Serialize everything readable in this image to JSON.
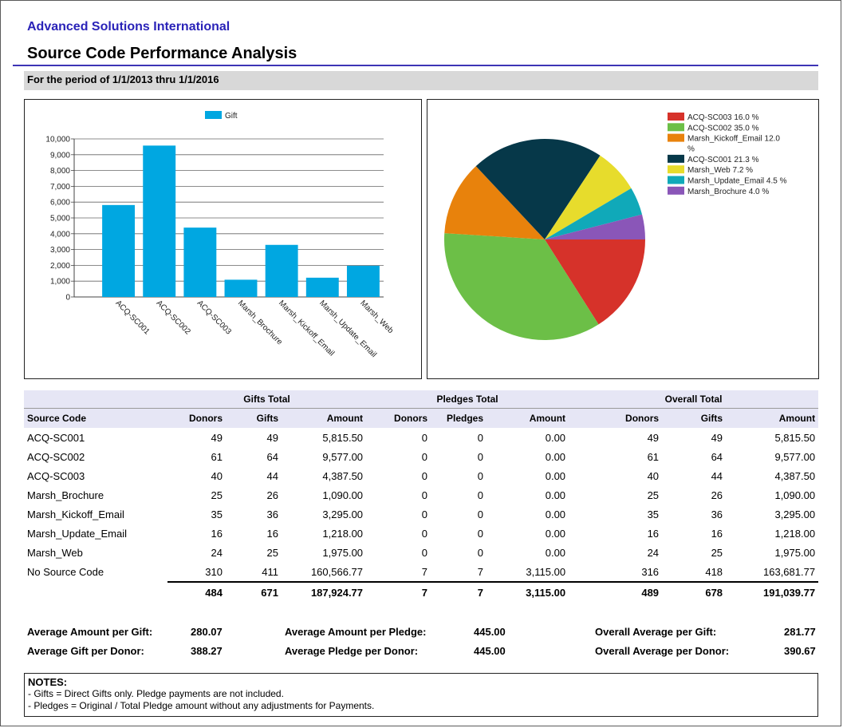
{
  "header": {
    "org": "Advanced Solutions International",
    "title": "Source Code Performance Analysis",
    "period": "For the period of 1/1/2013 thru 1/1/2016"
  },
  "chart_data": [
    {
      "type": "bar",
      "legend": [
        "Gift"
      ],
      "categories": [
        "ACQ-SC001",
        "ACQ-SC002",
        "ACQ-SC003",
        "Marsh_Brochure",
        "Marsh_Kickoff_Email",
        "Marsh_Update_Email",
        "Marsh_Web"
      ],
      "series": [
        {
          "name": "Gift",
          "values": [
            5815.5,
            9577.0,
            4387.5,
            1090.0,
            3295.0,
            1218.0,
            1975.0
          ]
        }
      ],
      "ylim": [
        0,
        10000
      ],
      "yticks": [
        "0",
        "1,000",
        "2,000",
        "3,000",
        "4,000",
        "5,000",
        "6,000",
        "7,000",
        "8,000",
        "9,000",
        "10,000"
      ],
      "grid": true,
      "legend_position": "top",
      "color": "#00a7e1"
    },
    {
      "type": "pie",
      "legend_position": "top-right",
      "slices": [
        {
          "label": "ACQ-SC003 16.0 %",
          "value": 16.0,
          "color": "#d6322a"
        },
        {
          "label": "ACQ-SC002 35.0 %",
          "value": 35.0,
          "color": "#6cbf47"
        },
        {
          "label": "Marsh_Kickoff_Email 12.0 %",
          "value": 12.0,
          "color": "#e8820c"
        },
        {
          "label": "ACQ-SC001 21.3 %",
          "value": 21.3,
          "color": "#063849"
        },
        {
          "label": "Marsh_Web 7.2 %",
          "value": 7.2,
          "color": "#e7dc2c"
        },
        {
          "label": "Marsh_Update_Email 4.5 %",
          "value": 4.5,
          "color": "#10a9b9"
        },
        {
          "label": "Marsh_Brochure 4.0 %",
          "value": 4.0,
          "color": "#8a56b8"
        }
      ]
    }
  ],
  "table": {
    "groups": [
      "Gifts Total",
      "Pledges Total",
      "Overall Total"
    ],
    "columns": [
      "Source Code",
      "Donors",
      "Gifts",
      "Amount",
      "Donors",
      "Pledges",
      "Amount",
      "Donors",
      "Gifts",
      "Amount"
    ],
    "rows": [
      [
        "ACQ-SC001",
        "49",
        "49",
        "5,815.50",
        "0",
        "0",
        "0.00",
        "49",
        "49",
        "5,815.50"
      ],
      [
        "ACQ-SC002",
        "61",
        "64",
        "9,577.00",
        "0",
        "0",
        "0.00",
        "61",
        "64",
        "9,577.00"
      ],
      [
        "ACQ-SC003",
        "40",
        "44",
        "4,387.50",
        "0",
        "0",
        "0.00",
        "40",
        "44",
        "4,387.50"
      ],
      [
        "Marsh_Brochure",
        "25",
        "26",
        "1,090.00",
        "0",
        "0",
        "0.00",
        "25",
        "26",
        "1,090.00"
      ],
      [
        "Marsh_Kickoff_Email",
        "35",
        "36",
        "3,295.00",
        "0",
        "0",
        "0.00",
        "35",
        "36",
        "3,295.00"
      ],
      [
        "Marsh_Update_Email",
        "16",
        "16",
        "1,218.00",
        "0",
        "0",
        "0.00",
        "16",
        "16",
        "1,218.00"
      ],
      [
        "Marsh_Web",
        "24",
        "25",
        "1,975.00",
        "0",
        "0",
        "0.00",
        "24",
        "25",
        "1,975.00"
      ],
      [
        "No Source Code",
        "310",
        "411",
        "160,566.77",
        "7",
        "7",
        "3,115.00",
        "316",
        "418",
        "163,681.77"
      ]
    ],
    "totals": [
      "",
      "484",
      "671",
      "187,924.77",
      "7",
      "7",
      "3,115.00",
      "489",
      "678",
      "191,039.77"
    ]
  },
  "averages": [
    {
      "label": "Average Amount per Gift:",
      "value": "280.07"
    },
    {
      "label": "Average Gift per Donor:",
      "value": "388.27"
    },
    {
      "label": "Average Amount per Pledge:",
      "value": "445.00"
    },
    {
      "label": "Average Pledge per Donor:",
      "value": "445.00"
    },
    {
      "label": "Overall Average per Gift:",
      "value": "281.77"
    },
    {
      "label": "Overall Average per Donor:",
      "value": "390.67"
    }
  ],
  "notes": {
    "title": "NOTES:",
    "lines": [
      "- Gifts = Direct Gifts only. Pledge payments are not included.",
      "- Pledges = Original / Total Pledge amount without any adjustments for Payments."
    ]
  }
}
